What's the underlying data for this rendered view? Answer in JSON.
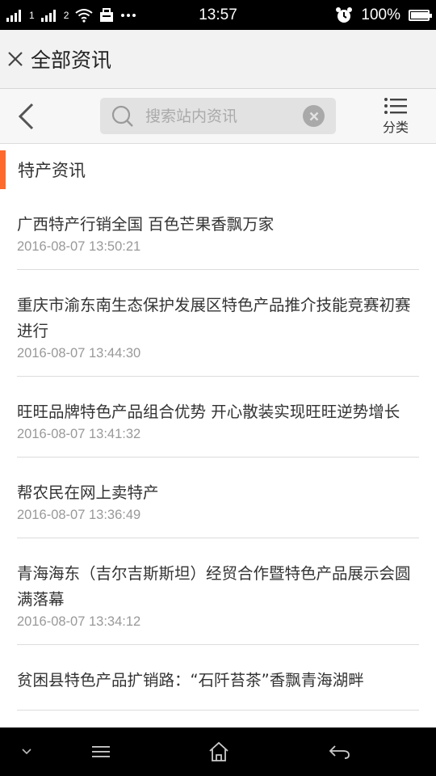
{
  "status_bar": {
    "signal_1_label": "1",
    "signal_2_label": "2",
    "time": "13:57",
    "battery": "100%",
    "battery_level": 1.0
  },
  "header": {
    "title": "全部资讯"
  },
  "search": {
    "placeholder": "搜索站内资讯",
    "category_label": "分类"
  },
  "section": {
    "title": "特产资讯",
    "accent_color": "#ff6a2b"
  },
  "news": [
    {
      "title": "广西特产行销全国 百色芒果香飘万家",
      "date": "2016-08-07 13:50:21"
    },
    {
      "title": "重庆市渝东南生态保护发展区特色产品推介技能竞赛初赛进行",
      "date": "2016-08-07 13:44:30"
    },
    {
      "title": "旺旺品牌特色产品组合优势 开心散装实现旺旺逆势增长",
      "date": "2016-08-07 13:41:32"
    },
    {
      "title": "帮农民在网上卖特产",
      "date": "2016-08-07 13:36:49"
    },
    {
      "title": "青海海东（吉尔吉斯斯坦）经贸合作暨特色产品展示会圆满落幕",
      "date": "2016-08-07 13:34:12"
    },
    {
      "title": "贫困县特色产品扩销路：“石阡苔茶”香飘青海湖畔",
      "date": ""
    }
  ]
}
